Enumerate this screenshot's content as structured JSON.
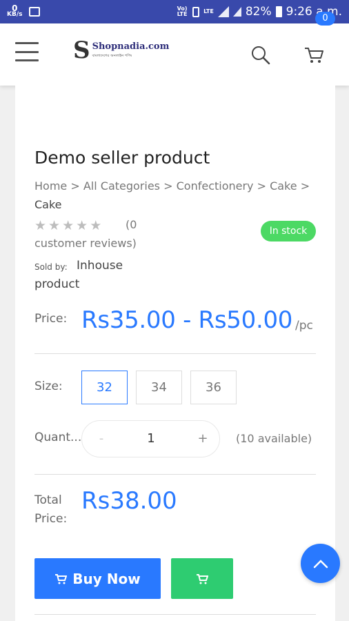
{
  "status_bar": {
    "net_speed_value": "0",
    "net_speed_unit": "KB/s",
    "volte": "Vo) LTE",
    "lte": "LTE",
    "battery": "82%",
    "time": "9:26 a.m."
  },
  "header": {
    "logo_name": "Shopnadia.com",
    "logo_tagline": "বাংলাদেশের অনলাইন শপিং",
    "cart_count": "0"
  },
  "product": {
    "title": "Demo seller product",
    "breadcrumb": [
      "Home",
      ">",
      "All Categories",
      ">",
      "Confectionery",
      ">",
      "Cake",
      ">"
    ],
    "breadcrumb_current": "Cake",
    "rating_stars": 0,
    "reviews_count": "(0",
    "reviews_text": "customer reviews)",
    "stock_status": "In stock",
    "sold_by_label": "Sold by:",
    "sold_by_value": "Inhouse product",
    "price_label": "Price:",
    "price_range": "Rs35.00 - Rs50.00",
    "price_unit": "/pc",
    "size_label": "Size:",
    "sizes": [
      "32",
      "34",
      "36"
    ],
    "selected_size": "32",
    "quantity_label": "Quant...",
    "quantity_minus": "-",
    "quantity_value": "1",
    "quantity_plus": "+",
    "available": "(10 available)",
    "total_label": "Total Price:",
    "total_value": "Rs38.00",
    "buy_now_label": "Buy Now"
  },
  "colors": {
    "accent": "#2979ff",
    "in_stock": "#4cd964",
    "add_to_cart": "#2ecc71",
    "status_bar": "#3949ab"
  },
  "icons": {
    "menu": "hamburger-icon",
    "search": "search-icon",
    "cart": "cart-icon",
    "scroll_top": "chevron-up-icon"
  }
}
